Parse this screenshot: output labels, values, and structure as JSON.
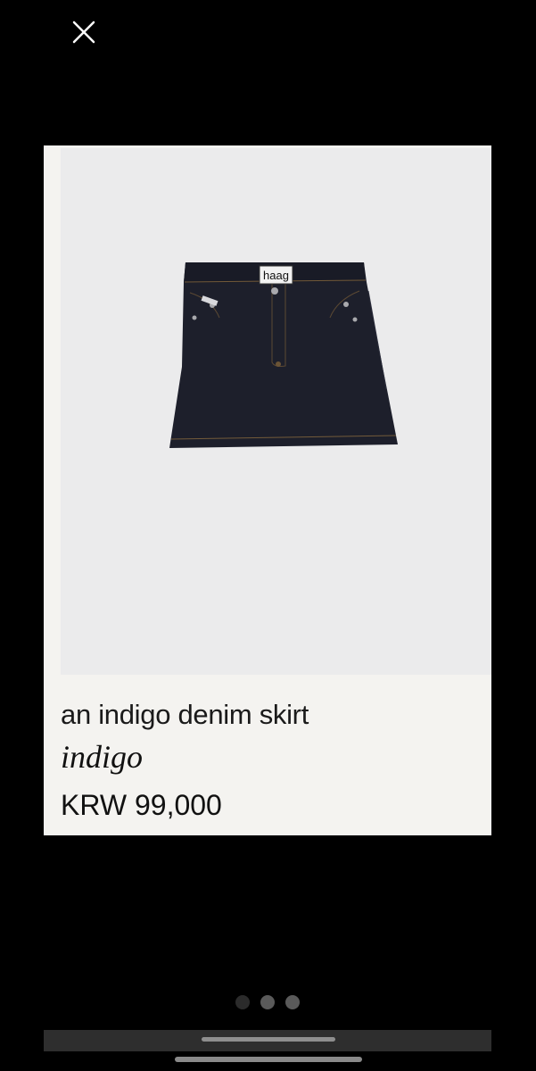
{
  "viewer": {
    "close_icon": "close-icon"
  },
  "product": {
    "image_alt": "indigo denim mini skirt",
    "brand_tag": "haag",
    "title": "an indigo denim skirt",
    "color": "indigo",
    "price": "KRW 99,000"
  },
  "gallery": {
    "page_count": 3,
    "current_page": 1
  },
  "colors": {
    "background": "#000000",
    "card": "#f4f3f0",
    "photo_bg": "#ebebec",
    "denim": "#1d1f2b",
    "stitch": "#8a6a3e"
  }
}
